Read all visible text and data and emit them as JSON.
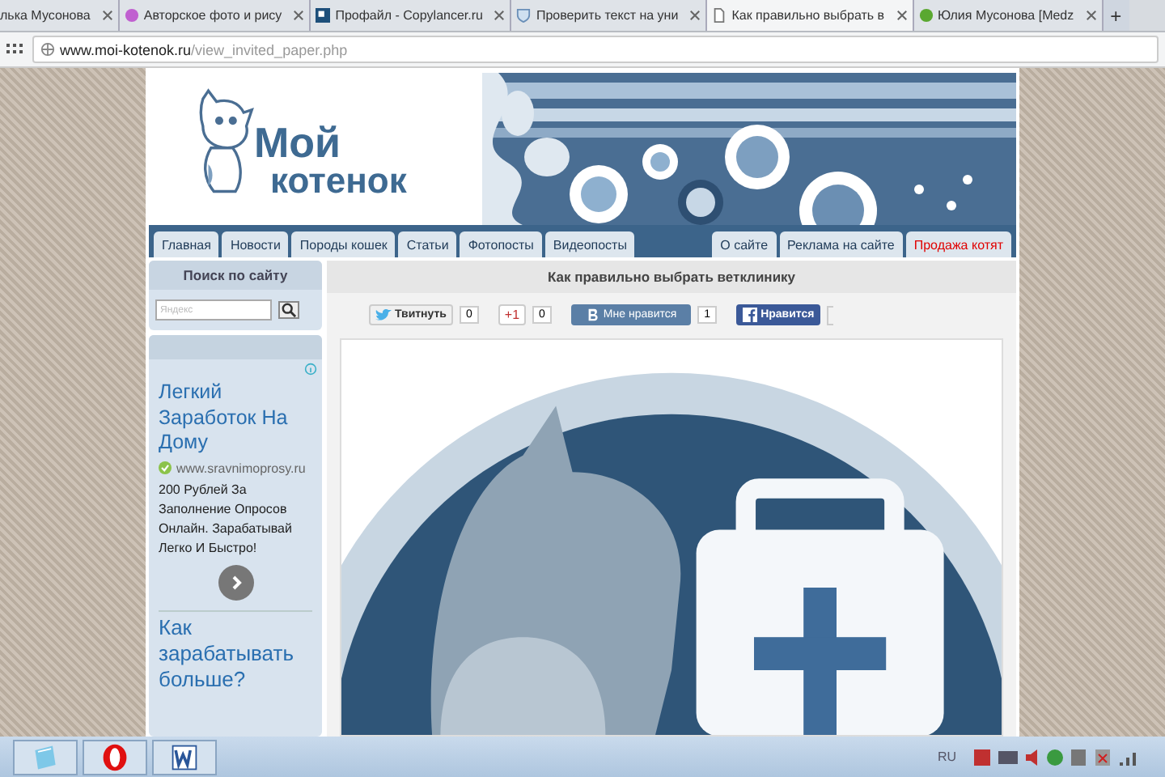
{
  "browser": {
    "tabs": [
      {
        "title": "лька Мусонова",
        "selected": false
      },
      {
        "title": "Авторское фото и рису",
        "selected": false
      },
      {
        "title": "Профайл - Copylancer.ru",
        "selected": false
      },
      {
        "title": "Проверить текст на уни",
        "selected": false
      },
      {
        "title": "Как правильно выбрать в",
        "selected": true
      },
      {
        "title": "Юлия Мусонова [Medz",
        "selected": false
      }
    ],
    "new_tab": "+",
    "address": {
      "domain": "www.moi-kotenok.ru",
      "path": "/view_invited_paper.php"
    }
  },
  "site": {
    "logo": {
      "line1": "Мой",
      "line2": "котенок"
    },
    "nav_left": [
      {
        "label": "Главная",
        "accent": false
      },
      {
        "label": "Новости",
        "accent": false
      },
      {
        "label": "Породы кошек",
        "accent": false
      },
      {
        "label": "Статьи",
        "accent": false
      },
      {
        "label": "Фотопосты",
        "accent": false
      },
      {
        "label": "Видеопосты",
        "accent": false
      }
    ],
    "nav_right": [
      {
        "label": "О сайте",
        "accent": false
      },
      {
        "label": "Реклама на сайте",
        "accent": false
      },
      {
        "label": "Продажа котят",
        "accent": true
      }
    ],
    "sidebar": {
      "search_title": "Поиск по сайту",
      "search_placeholder": "Яндекс",
      "ad": {
        "title": "Легкий Заработок На Дому",
        "url": "www.sravnimoprosy.ru",
        "text": "200 Рублей За Заполнение Опросов Онлайн. Зарабатывай Легко И Быстро!",
        "more": "Как зарабатывать больше?"
      }
    },
    "article": {
      "title": "Как правильно выбрать ветклинику",
      "social": [
        {
          "kind": "twitter",
          "label": "Твитнуть",
          "count": "0"
        },
        {
          "kind": "gplus",
          "label": "+1",
          "count": "0"
        },
        {
          "kind": "vk",
          "label": "Мне нравится",
          "count": "1"
        },
        {
          "kind": "facebook",
          "label": "Нравится"
        }
      ]
    }
  },
  "taskbar": {
    "language": "RU"
  }
}
